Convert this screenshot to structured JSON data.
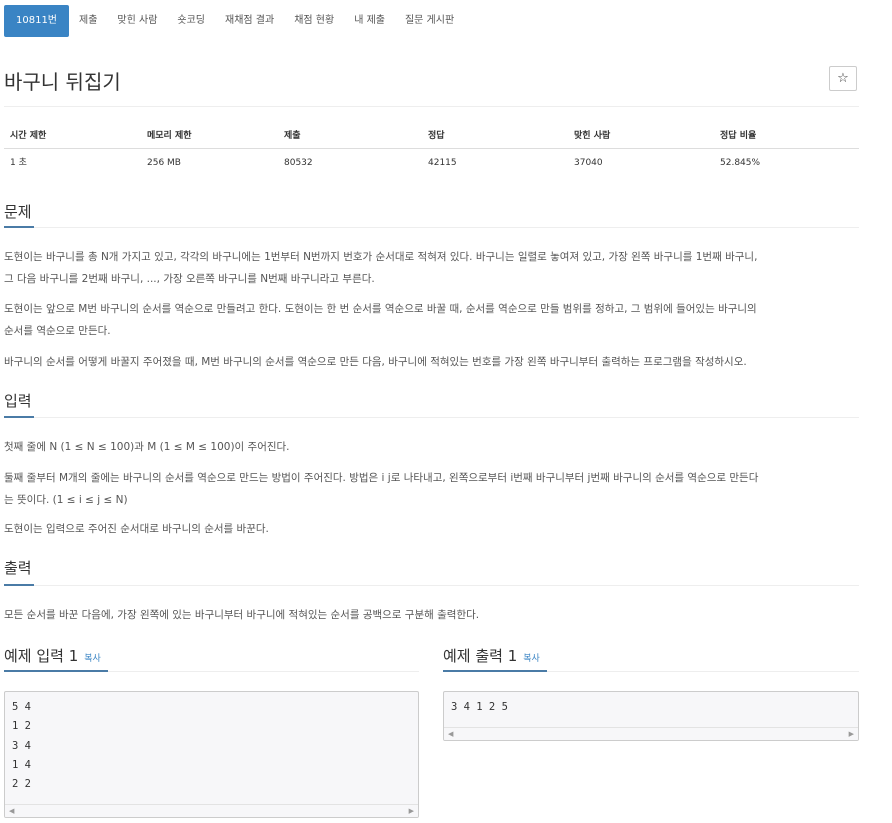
{
  "nav": {
    "items": [
      {
        "label": "10811번",
        "active": true
      },
      {
        "label": "제출"
      },
      {
        "label": "맞힌 사람"
      },
      {
        "label": "숏코딩"
      },
      {
        "label": "재채점 결과"
      },
      {
        "label": "채점 현황"
      },
      {
        "label": "내 제출"
      },
      {
        "label": "질문 게시판"
      }
    ]
  },
  "problem": {
    "title": "바구니 뒤집기",
    "star_icon": "☆"
  },
  "info": {
    "headers": [
      "시간 제한",
      "메모리 제한",
      "제출",
      "정답",
      "맞힌 사람",
      "정답 비율"
    ],
    "values": [
      "1 초",
      "256 MB",
      "80532",
      "42115",
      "37040",
      "52.845%"
    ]
  },
  "sections": {
    "description": {
      "title": "문제",
      "paragraphs": [
        [
          "도현이는 바구니를 총 N개 가지고 있고, 각각의 바구니에는 1번부터 N번까지 번호가 순서대로 적혀져 있다. 바구니는 일렬로 놓여져 있고, 가장 왼쪽 바구니를 1번째 바구니,",
          "그 다음 바구니를 2번째 바구니, ..., 가장 오른쪽 바구니를 N번째 바구니라고 부른다."
        ],
        [
          "도현이는 앞으로 M번 바구니의 순서를 역순으로 만들려고 한다. 도현이는 한 번 순서를 역순으로 바꿀 때, 순서를 역순으로 만들 범위를 정하고, 그 범위에 들어있는 바구니의",
          "순서를 역순으로 만든다."
        ],
        [
          "바구니의 순서를 어떻게 바꿀지 주어졌을 때, M번 바구니의 순서를 역순으로 만든 다음, 바구니에 적혀있는 번호를 가장 왼쪽 바구니부터 출력하는 프로그램을 작성하시오."
        ]
      ]
    },
    "input": {
      "title": "입력",
      "paragraphs": [
        [
          "첫째 줄에 N (1 ≤ N ≤ 100)과 M (1 ≤ M ≤ 100)이 주어진다."
        ],
        [
          "둘째 줄부터 M개의 줄에는 바구니의 순서를 역순으로 만드는 방법이 주어진다. 방법은 i j로 나타내고, 왼쪽으로부터 i번째 바구니부터 j번째 바구니의 순서를 역순으로 만든다",
          "는 뜻이다. (1 ≤ i ≤ j ≤ N)"
        ],
        [
          "도현이는 입력으로 주어진 순서대로 바구니의 순서를 바꾼다."
        ]
      ]
    },
    "output": {
      "title": "출력",
      "paragraphs": [
        [
          "모든 순서를 바꾼 다음에, 가장 왼쪽에 있는 바구니부터 바구니에 적혀있는 순서를 공백으로 구분해 출력한다."
        ]
      ]
    }
  },
  "samples": {
    "copy_label": "복사",
    "input": {
      "title": "예제 입력 1",
      "lines": [
        "5 4",
        "1 2",
        "3 4",
        "1 4",
        "2 2"
      ]
    },
    "output": {
      "title": "예제 출력 1",
      "lines": [
        "3 4 1 2 5"
      ]
    }
  },
  "scroll": {
    "left_icon": "◀",
    "right_icon": "▶"
  }
}
